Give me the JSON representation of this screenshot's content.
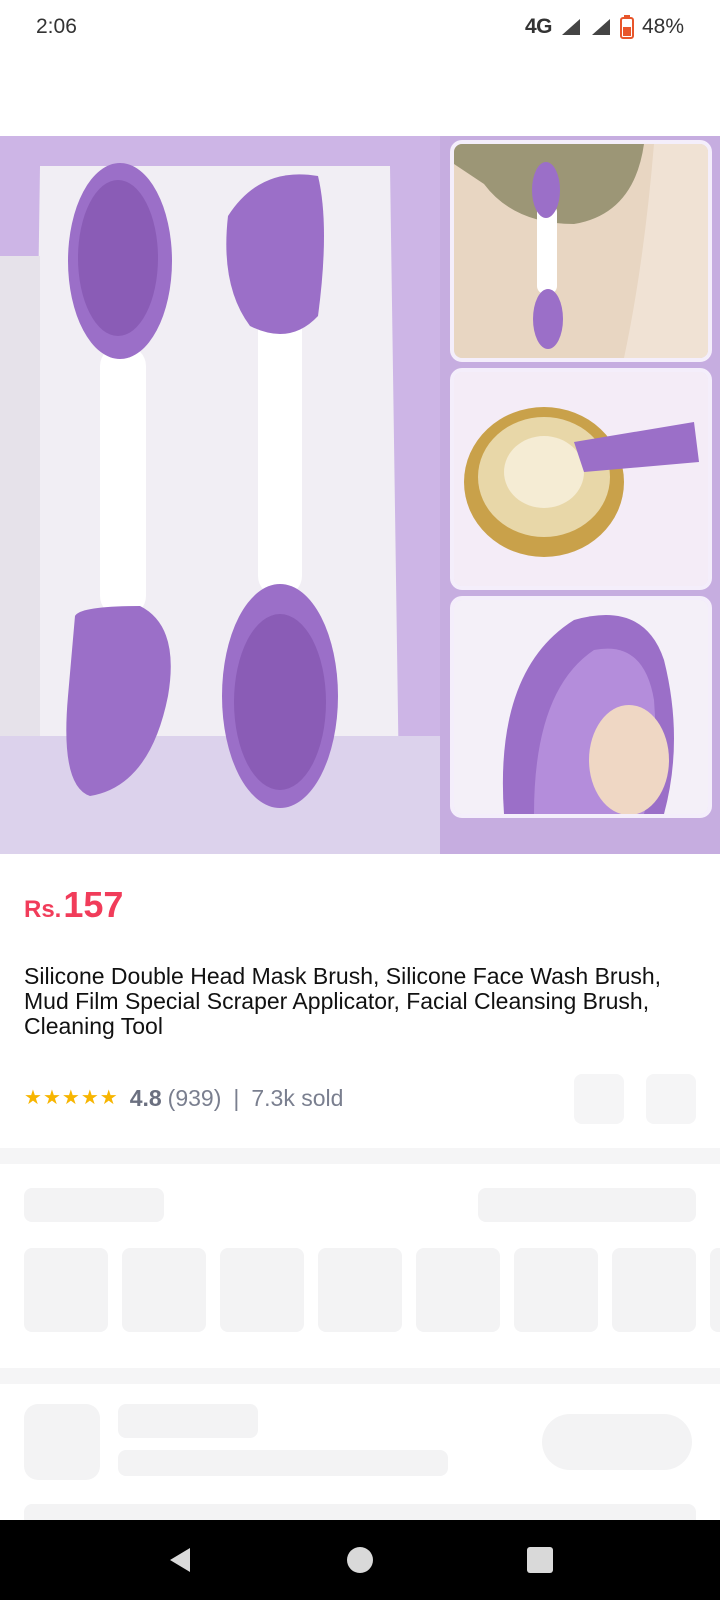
{
  "status_bar": {
    "time": "2:06",
    "network": "4G",
    "battery": "48%"
  },
  "product": {
    "currency": "Rs.",
    "price": "157",
    "title": "Silicone Double Head Mask Brush, Silicone Face Wash Brush, Mud Film Special Scraper Applicator, Facial Cleansing Brush, Cleaning Tool",
    "rating": "4.8",
    "reviews": "(939)",
    "separator": "|",
    "sold": "7.3k sold"
  },
  "icons": {
    "stars": [
      "star-icon",
      "star-icon",
      "star-icon",
      "star-icon",
      "star-half-icon"
    ],
    "nav": [
      "back-icon",
      "home-icon",
      "recents-icon"
    ]
  },
  "colors": {
    "price": "#f13c5a",
    "star": "#f7b500",
    "product_purple": "#9b6fc8"
  }
}
